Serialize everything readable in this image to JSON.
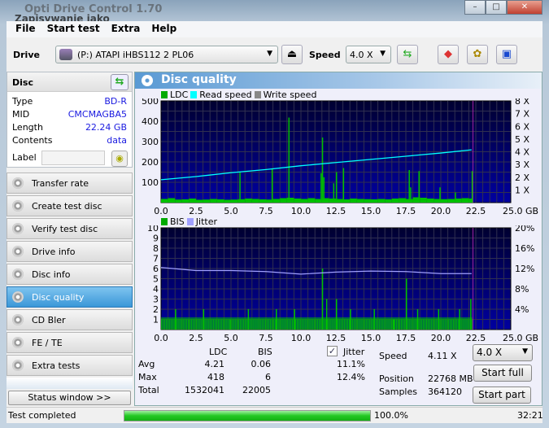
{
  "window": {
    "title": "Opti Drive Control 1.70",
    "overlay_title": "Zapisywanie jako"
  },
  "menu": [
    "File",
    "Start test",
    "Extra",
    "Help"
  ],
  "toolbar": {
    "drive_label": "Drive",
    "drive_value": "(P:)  ATAPI iHBS112  2 PL06",
    "speed_label": "Speed",
    "speed_value": "4.0 X"
  },
  "disc": {
    "header": "Disc",
    "fields": [
      {
        "k": "Type",
        "v": "BD-R"
      },
      {
        "k": "MID",
        "v": "CMCMAGBA5"
      },
      {
        "k": "Length",
        "v": "22.24 GB"
      },
      {
        "k": "Contents",
        "v": "data"
      }
    ],
    "label_key": "Label",
    "label_value": ""
  },
  "nav": [
    {
      "label": "Transfer rate"
    },
    {
      "label": "Create test disc"
    },
    {
      "label": "Verify test disc"
    },
    {
      "label": "Drive info"
    },
    {
      "label": "Disc info"
    },
    {
      "label": "Disc quality",
      "active": true
    },
    {
      "label": "CD Bler"
    },
    {
      "label": "FE / TE"
    },
    {
      "label": "Extra tests"
    }
  ],
  "status_window_button": "Status window >>",
  "panel_title": "Disc quality",
  "colors": {
    "ldc": "#00c000",
    "read_speed": "#00ffff",
    "write_speed": "#888888",
    "bis": "#00c000",
    "jitter": "#a0a0ff",
    "plot_bg": "#000060",
    "accent": "#1a1ae0"
  },
  "chart_data": [
    {
      "type": "bar",
      "legend": [
        "LDC",
        "Read speed",
        "Write speed"
      ],
      "xlim": [
        0,
        25
      ],
      "ylim": [
        0,
        500
      ],
      "y2lim": [
        0,
        8
      ],
      "x_ticks": [
        "0.0",
        "2.5",
        "5.0",
        "7.5",
        "10.0",
        "12.5",
        "15.0",
        "17.5",
        "20.0",
        "22.5",
        "25.0 GB"
      ],
      "y_ticks": [
        "500",
        "400",
        "300",
        "200",
        "100"
      ],
      "y2_ticks": [
        "8 X",
        "7 X",
        "6 X",
        "5 X",
        "4 X",
        "3 X",
        "2 X",
        "1 X"
      ],
      "ldc_baseline": [
        18,
        22,
        15,
        16,
        20,
        14,
        15,
        18,
        16,
        14,
        15,
        17,
        20,
        18,
        16,
        15,
        18,
        22,
        24,
        20,
        18,
        22,
        18,
        22,
        20,
        18,
        16,
        20,
        18,
        17,
        16,
        18,
        16,
        20,
        22,
        18,
        26,
        24,
        20,
        18,
        17,
        18,
        20,
        22,
        20
      ],
      "ldc_spikes": [
        [
          5.6,
          150
        ],
        [
          7.9,
          165
        ],
        [
          9.1,
          418
        ],
        [
          11.4,
          145
        ],
        [
          11.5,
          320
        ],
        [
          11.6,
          125
        ],
        [
          12.3,
          95
        ],
        [
          12.5,
          150
        ],
        [
          13.0,
          170
        ],
        [
          17.7,
          160
        ],
        [
          17.8,
          75
        ],
        [
          18.4,
          155
        ],
        [
          19.9,
          75
        ],
        [
          21.0,
          50
        ],
        [
          22.2,
          155
        ]
      ],
      "read_speed": [
        [
          0,
          1.8
        ],
        [
          2.5,
          2.05
        ],
        [
          5,
          2.35
        ],
        [
          7.5,
          2.6
        ],
        [
          10,
          2.9
        ],
        [
          12.5,
          3.15
        ],
        [
          15,
          3.4
        ],
        [
          17.5,
          3.65
        ],
        [
          20,
          3.9
        ],
        [
          22.2,
          4.15
        ]
      ]
    },
    {
      "type": "bar",
      "legend": [
        "BIS",
        "Jitter"
      ],
      "xlim": [
        0,
        25
      ],
      "ylim": [
        0,
        10
      ],
      "y2lim": [
        0,
        20
      ],
      "x_ticks": [
        "0.0",
        "2.5",
        "5.0",
        "7.5",
        "10.0",
        "12.5",
        "15.0",
        "17.5",
        "20.0",
        "22.5",
        "25.0 GB"
      ],
      "y_ticks": [
        "10",
        "9",
        "8",
        "7",
        "6",
        "5",
        "4",
        "3",
        "2",
        "1"
      ],
      "y2_ticks": [
        "20%",
        "16%",
        "12%",
        "8%",
        "4%"
      ],
      "bis_spikes": [
        [
          1,
          2
        ],
        [
          3,
          2
        ],
        [
          4.9,
          1
        ],
        [
          6.2,
          2
        ],
        [
          8.2,
          2
        ],
        [
          9.5,
          2
        ],
        [
          11.5,
          6
        ],
        [
          11.8,
          3
        ],
        [
          12.5,
          3
        ],
        [
          13.5,
          2
        ],
        [
          15.2,
          2
        ],
        [
          16.6,
          1
        ],
        [
          17.5,
          5
        ],
        [
          18.3,
          2
        ],
        [
          19.8,
          2
        ],
        [
          21.3,
          2
        ],
        [
          22.1,
          3
        ]
      ],
      "jitter": [
        [
          0,
          12.2
        ],
        [
          2.5,
          11.6
        ],
        [
          5,
          11.6
        ],
        [
          7.5,
          11.4
        ],
        [
          10,
          10.9
        ],
        [
          12.5,
          11.3
        ],
        [
          15,
          11.5
        ],
        [
          17.5,
          11.4
        ],
        [
          20,
          11.0
        ],
        [
          22.2,
          11.0
        ]
      ]
    }
  ],
  "stats": {
    "col_ldc": "LDC",
    "col_bis": "BIS",
    "jitter_label": "Jitter",
    "jitter_checked": true,
    "rows": [
      {
        "k": "Avg",
        "ldc": "4.21",
        "bis": "0.06",
        "jitter": "11.1%"
      },
      {
        "k": "Max",
        "ldc": "418",
        "bis": "6",
        "jitter": "12.4%"
      },
      {
        "k": "Total",
        "ldc": "1532041",
        "bis": "22005",
        "jitter": ""
      }
    ],
    "speed_label": "Speed",
    "speed_value": "4.11 X",
    "position_label": "Position",
    "position_value": "22768 MB",
    "samples_label": "Samples",
    "samples_value": "364120",
    "speed_select": "4.0 X",
    "start_full": "Start full",
    "start_part": "Start part"
  },
  "statusbar": {
    "text": "Test completed",
    "progress": 100,
    "progress_text": "100.0%",
    "time": "32:21"
  }
}
